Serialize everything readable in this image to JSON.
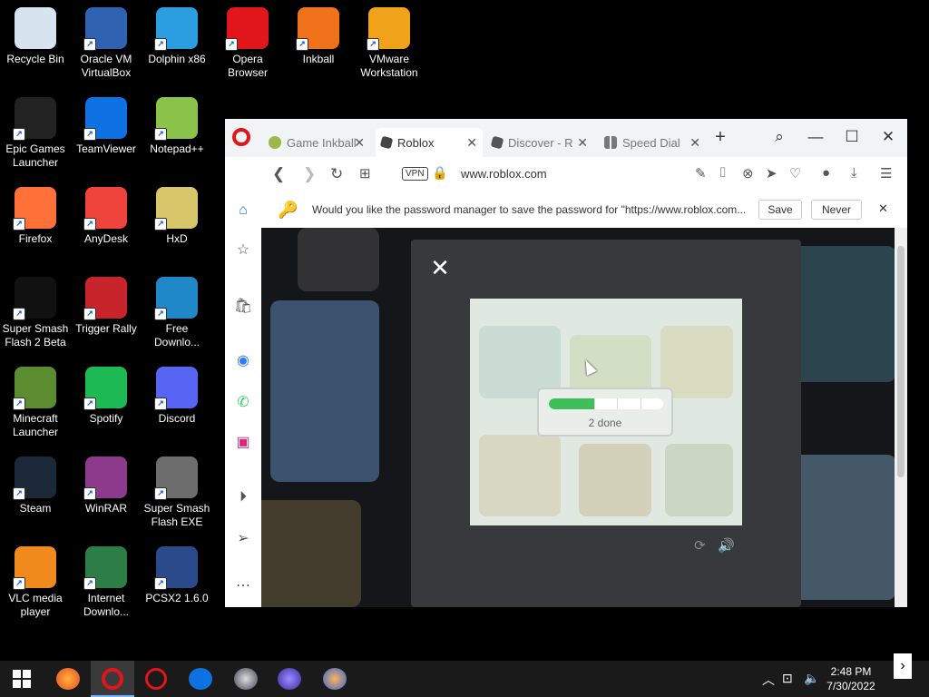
{
  "desktop": {
    "icons": [
      {
        "label": "Recycle Bin",
        "icon": "recycle-bin-icon",
        "color": "#d7e3ee"
      },
      {
        "label": "Oracle VM VirtualBox",
        "icon": "virtualbox-icon",
        "color": "#2f63b1"
      },
      {
        "label": "Dolphin x86",
        "icon": "dolphin-icon",
        "color": "#2a9ee0"
      },
      {
        "label": "Opera Browser",
        "icon": "opera-icon",
        "color": "#e0161b"
      },
      {
        "label": "Inkball",
        "icon": "inkball-icon",
        "color": "#f0731c"
      },
      {
        "label": "VMware Workstation",
        "icon": "vmware-icon",
        "color": "#f1a21b"
      },
      {
        "label": "Epic Games Launcher",
        "icon": "epic-games-icon",
        "color": "#222222"
      },
      {
        "label": "TeamViewer",
        "icon": "teamviewer-icon",
        "color": "#0e72e3"
      },
      {
        "label": "Notepad++",
        "icon": "notepad-plus-plus-icon",
        "color": "#8bc34a"
      },
      {
        "label": "Firefox",
        "icon": "firefox-icon",
        "color": "#ff7139"
      },
      {
        "label": "AnyDesk",
        "icon": "anydesk-icon",
        "color": "#ef443b"
      },
      {
        "label": "HxD",
        "icon": "hxd-icon",
        "color": "#d8c66a"
      },
      {
        "label": "Super Smash Flash 2 Beta",
        "icon": "ssf2-icon",
        "color": "#111111"
      },
      {
        "label": "Trigger Rally",
        "icon": "trigger-rally-icon",
        "color": "#c7242b"
      },
      {
        "label": "Free Downlo...",
        "icon": "free-download-icon",
        "color": "#1e88c8"
      },
      {
        "label": "Minecraft Launcher",
        "icon": "minecraft-icon",
        "color": "#5b8c2f"
      },
      {
        "label": "Spotify",
        "icon": "spotify-icon",
        "color": "#1db954"
      },
      {
        "label": "Discord",
        "icon": "discord-icon",
        "color": "#5865f2"
      },
      {
        "label": "Steam",
        "icon": "steam-icon",
        "color": "#1b2838"
      },
      {
        "label": "WinRAR",
        "icon": "winrar-icon",
        "color": "#8e3a8c"
      },
      {
        "label": "Super Smash Flash EXE",
        "icon": "flash-icon",
        "color": "#6d6d6d"
      },
      {
        "label": "VLC media player",
        "icon": "vlc-icon",
        "color": "#f08a1c"
      },
      {
        "label": "Internet Downlo...",
        "icon": "idm-icon",
        "color": "#2d7d46"
      },
      {
        "label": "PCSX2 1.6.0",
        "icon": "pcsx2-icon",
        "color": "#2b4a8a"
      }
    ]
  },
  "browser": {
    "tabs": [
      {
        "label": "Game Inkball",
        "icon": "inkball-favicon",
        "active": false
      },
      {
        "label": "Roblox",
        "icon": "roblox-favicon",
        "active": true
      },
      {
        "label": "Discover - R",
        "icon": "discover-favicon",
        "active": false
      },
      {
        "label": "Speed Dial",
        "icon": "speed-dial-favicon",
        "active": false
      }
    ],
    "url": "www.roblox.com",
    "vpn_label": "VPN",
    "password_prompt": {
      "message": "Would you like the password manager to save the password for \"https://www.roblox.com...",
      "save_label": "Save",
      "never_label": "Never"
    },
    "captcha": {
      "progress_text": "2 done",
      "completed": 2,
      "total": 5
    }
  },
  "taskbar": {
    "time": "2:48 PM",
    "date": "7/30/2022"
  },
  "colors": {
    "opera_red": "#e0161b",
    "accent_blue": "#1a73e8",
    "progress_green": "#3fbf5a",
    "modal_bg": "#38393c"
  }
}
